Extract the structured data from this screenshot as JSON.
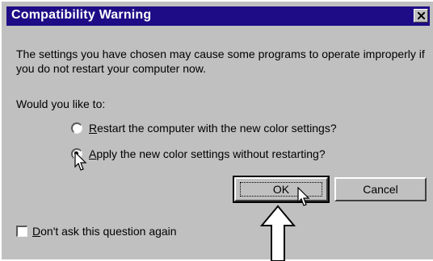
{
  "dialog": {
    "title": "Compatibility Warning",
    "message": "The settings you have chosen may cause some programs to operate improperly if you do not restart your computer now.",
    "prompt": "Would you like to:",
    "options": [
      {
        "accel": "R",
        "rest": "estart the computer with the new color settings?",
        "selected": false
      },
      {
        "accel": "A",
        "rest": "pply the new color settings without restarting?",
        "selected": true
      }
    ],
    "ok_label": "OK",
    "cancel_label": "Cancel",
    "checkbox": {
      "accel": "D",
      "rest": "on't ask this question again",
      "checked": false
    }
  },
  "colors": {
    "titlebar": "#1d0c86",
    "face": "#c0c0c0"
  }
}
